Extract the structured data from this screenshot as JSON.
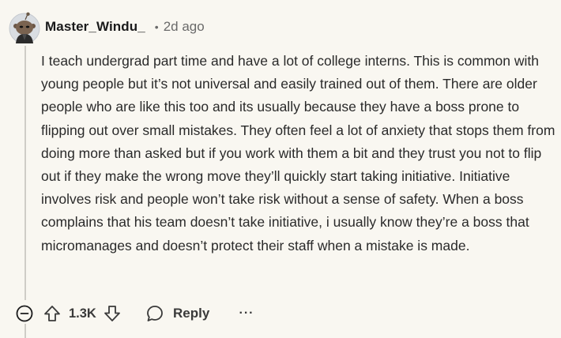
{
  "comment": {
    "username": "Master_Windu_",
    "separator": "•",
    "timestamp": "2d ago",
    "body": "I teach undergrad part time and have a lot of college interns. This is common with young people but it’s not universal and easily trained out of them. There are older people who are like this too and its usually because they have a boss prone to flipping out over small mistakes. They often feel a lot of anxiety that stops them from doing more than asked but if you work with them a bit and they trust you not to flip out if they make the wrong move they’ll quickly start taking initiative. Initiative involves risk and people won’t take risk without a sense of safety. When a boss complains that his team doesn’t take initiative, i usually know they’re a boss that micromanages and doesn’t protect their staff when a mistake is made.",
    "score": "1.3K",
    "reply_label": "Reply",
    "more_label": "···"
  },
  "icons": {
    "avatar": "snoo-avatar",
    "collapse": "collapse-minus-icon",
    "upvote": "upvote-arrow-icon",
    "downvote": "downvote-arrow-icon",
    "reply": "speech-bubble-icon",
    "more": "more-options-icon"
  },
  "colors": {
    "background": "#f9f7f1",
    "text": "#2a2a2a",
    "muted": "#6a6a6a",
    "thread_line": "#cfcdc7"
  }
}
